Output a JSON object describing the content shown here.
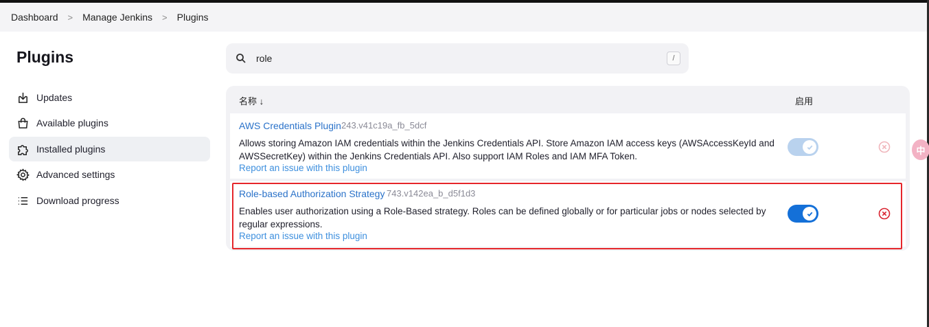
{
  "breadcrumb": {
    "items": [
      "Dashboard",
      "Manage Jenkins",
      "Plugins"
    ],
    "separator": ">"
  },
  "sidebar": {
    "title": "Plugins",
    "items": [
      {
        "label": "Updates",
        "icon": "download-icon"
      },
      {
        "label": "Available plugins",
        "icon": "shopping-bag-icon"
      },
      {
        "label": "Installed plugins",
        "icon": "puzzle-icon",
        "active": true
      },
      {
        "label": "Advanced settings",
        "icon": "gear-icon"
      },
      {
        "label": "Download progress",
        "icon": "list-icon"
      }
    ]
  },
  "search": {
    "value": "role",
    "shortcut": "/"
  },
  "table": {
    "header_name": "名称 ↓",
    "header_enabled": "启用",
    "plugins": [
      {
        "name": "AWS Credentials Plugin",
        "version": "243.v41c19a_fb_5dcf",
        "description": "Allows storing Amazon IAM credentials within the Jenkins Credentials API. Store Amazon IAM access keys (AWSAccessKeyId and AWSSecretKey) within the Jenkins Credentials API. Also support IAM Roles and IAM MFA Token.",
        "report": "Report an issue with this plugin",
        "enabled": true,
        "disabled_look": true
      },
      {
        "name": "Role-based Authorization Strategy",
        "version": "743.v142ea_b_d5f1d3",
        "description": "Enables user authorization using a Role-Based strategy. Roles can be defined globally or for particular jobs or nodes selected by regular expressions.",
        "report": "Report an issue with this plugin",
        "enabled": true,
        "disabled_look": false
      }
    ]
  },
  "colors": {
    "link": "#2a72c9",
    "toggle_on": "#1470d8",
    "toggle_faded": "#b9d2ee",
    "uninstall": "#d9232f",
    "highlight": "#e5252a"
  },
  "floating_bubble": "中"
}
